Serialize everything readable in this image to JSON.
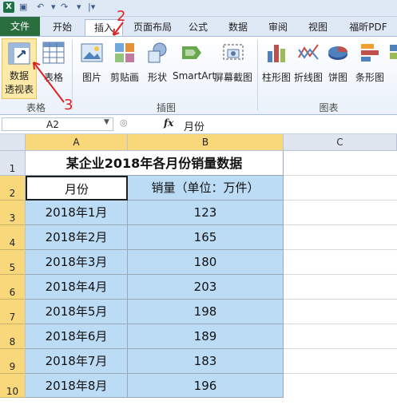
{
  "tabs": {
    "file": "文件",
    "home": "开始",
    "insert": "插入",
    "page_layout": "页面布局",
    "formulas": "公式",
    "data": "数据",
    "review": "审阅",
    "view": "视图",
    "foxit_pdf": "福昕PDF"
  },
  "ribbon": {
    "pivot_table_line1": "数据",
    "pivot_table_line2": "透视表",
    "table": "表格",
    "picture": "图片",
    "clip_art": "剪贴画",
    "shapes": "形状",
    "smartart": "SmartArt",
    "screenshot": "屏幕截图",
    "column_chart": "柱形图",
    "line_chart": "折线图",
    "pie_chart": "饼图",
    "bar_chart": "条形图",
    "group_tables": "表格",
    "group_illustrations": "插图",
    "group_charts": "图表"
  },
  "formula_bar": {
    "name_box": "A2",
    "fx": "fx",
    "value": "月份"
  },
  "columns": [
    "A",
    "B",
    "C"
  ],
  "rows": [
    "1",
    "2",
    "3",
    "4",
    "5",
    "6",
    "7",
    "8",
    "9",
    "10"
  ],
  "sheet": {
    "title": "某企业2018年各月份销量数据",
    "header_month": "月份",
    "header_sales": "销量（单位：万件）",
    "months": [
      "2018年1月",
      "2018年2月",
      "2018年3月",
      "2018年4月",
      "2018年5月",
      "2018年6月",
      "2018年7月",
      "2018年8月"
    ],
    "sales": [
      "123",
      "165",
      "180",
      "203",
      "198",
      "189",
      "183",
      "196"
    ]
  },
  "annotations": {
    "step2": "2",
    "step3": "3"
  },
  "colors": {
    "selection": "#bcdcf5",
    "header_highlight": "#f8d87a",
    "file_tab": "#2a6e3f",
    "annotation": "#e02020"
  }
}
